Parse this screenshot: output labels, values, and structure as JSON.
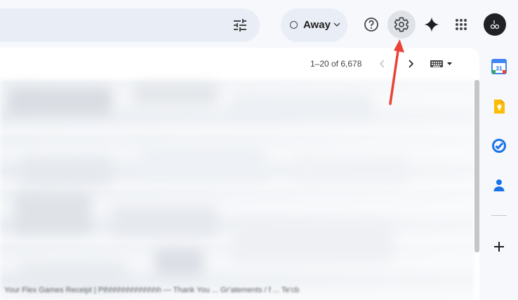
{
  "header": {
    "status": {
      "label": "Away"
    },
    "buttons": {
      "filter_icon": "tune-icon",
      "help_icon": "help-icon",
      "settings_icon": "gear-icon",
      "gemini_icon": "gemini-sparkle-icon",
      "apps_icon": "apps-grid-icon"
    }
  },
  "toolbar": {
    "pagination": "1–20 of 6,678"
  },
  "message_list": {
    "preview_text": "Your Flex Games Receipt | Pthhhhhhhhhhhhh — Thank You ... Gr'atements / f ... Te'cb"
  },
  "side_panel": {
    "apps": [
      {
        "name": "Calendar",
        "label": "31",
        "color": "#4285f4"
      },
      {
        "name": "Keep",
        "color": "#fbbc04"
      },
      {
        "name": "Tasks",
        "color": "#1a73e8"
      },
      {
        "name": "Contacts",
        "color": "#1a73e8"
      }
    ],
    "add_icon": "plus-icon"
  },
  "annotation": {
    "color": "#ea4335"
  }
}
